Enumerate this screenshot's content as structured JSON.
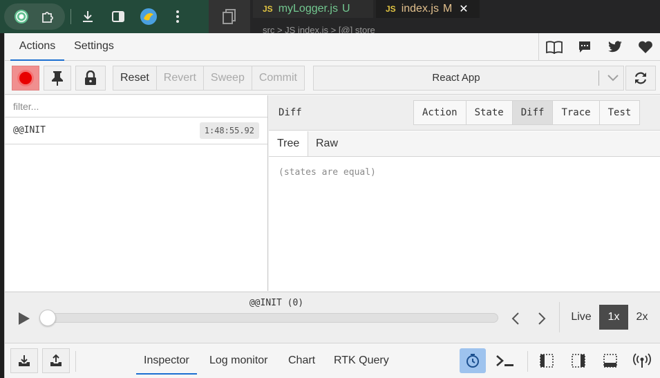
{
  "editor": {
    "tabs": [
      {
        "icon": "JS",
        "name": "myLogger.js",
        "flag": "U"
      },
      {
        "icon": "JS",
        "name": "index.js",
        "flag": "M",
        "close": "✕"
      }
    ],
    "breadcrumb": "src > JS index.js > [@] store"
  },
  "devtools": {
    "top_tabs": [
      "Actions",
      "Settings"
    ],
    "toolbar": {
      "buttons": [
        "Reset",
        "Revert",
        "Sweep",
        "Commit"
      ],
      "instance": "React App"
    },
    "filter_placeholder": "filter...",
    "actions": [
      {
        "name": "@@INIT",
        "time": "1:48:55.92"
      }
    ],
    "right": {
      "title": "Diff",
      "modes": [
        "Action",
        "State",
        "Diff",
        "Trace",
        "Test"
      ],
      "active_mode": "Diff",
      "sub_tabs": [
        "Tree",
        "Raw"
      ],
      "message": "(states are equal)"
    },
    "slider": {
      "label": "@@INIT (0)",
      "position": 0,
      "speeds": [
        "Live",
        "1x",
        "2x"
      ],
      "active_speed": "1x"
    },
    "footer": {
      "monitors": [
        "Inspector",
        "Log monitor",
        "Chart",
        "RTK Query"
      ],
      "active_monitor": "Inspector"
    }
  },
  "colors": {
    "accent": "#1b6fd1",
    "record": "#e80000",
    "browser_bar": "#234a3a"
  }
}
